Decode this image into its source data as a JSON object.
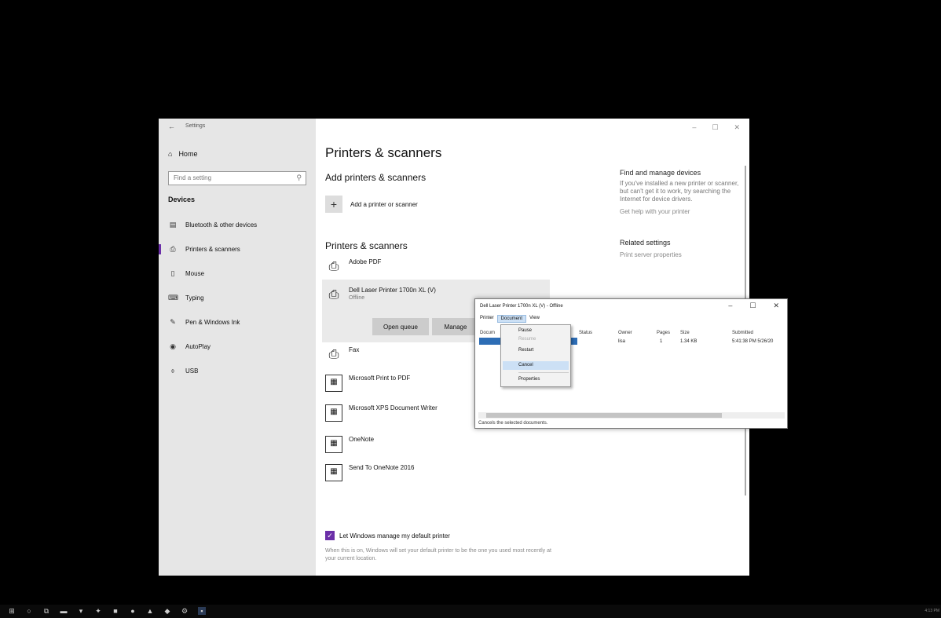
{
  "window": {
    "title": "Settings",
    "back": "←",
    "min": "–",
    "max": "☐",
    "close": "✕"
  },
  "sidebar": {
    "home": "Home",
    "search_placeholder": "Find a setting",
    "section": "Devices",
    "items": [
      {
        "label": "Bluetooth & other devices",
        "icon": "bluetooth-devices-icon"
      },
      {
        "label": "Printers & scanners",
        "icon": "printer-icon",
        "active": true
      },
      {
        "label": "Mouse",
        "icon": "mouse-icon"
      },
      {
        "label": "Typing",
        "icon": "keyboard-icon"
      },
      {
        "label": "Pen & Windows Ink",
        "icon": "pen-icon"
      },
      {
        "label": "AutoPlay",
        "icon": "autoplay-icon"
      },
      {
        "label": "USB",
        "icon": "usb-icon"
      }
    ]
  },
  "main": {
    "title": "Printers & scanners",
    "add_heading": "Add printers & scanners",
    "add_label": "Add a printer or scanner",
    "list_heading": "Printers & scanners",
    "printers": [
      {
        "name": "Adobe PDF",
        "status": ""
      },
      {
        "name": "Dell Laser Printer 1700n XL (V)",
        "status": "Offline"
      },
      {
        "name": "Fax",
        "status": ""
      },
      {
        "name": "Microsoft Print to PDF",
        "status": ""
      },
      {
        "name": "Microsoft XPS Document Writer",
        "status": ""
      },
      {
        "name": "OneNote",
        "status": ""
      },
      {
        "name": "Send To OneNote 2016",
        "status": ""
      }
    ],
    "open_queue": "Open queue",
    "manage": "Manage",
    "default_checkbox": "Let Windows manage my default printer",
    "default_note": "When this is on, Windows will set your default printer to be the one you used most recently at your current location."
  },
  "right": {
    "find_title": "Find and manage devices",
    "find_text": "If you've installed a new printer or scanner, but can't get it to work, try searching the Internet for device drivers.",
    "help_link": "Get help with your printer",
    "related_title": "Related settings",
    "print_server": "Print server properties"
  },
  "queue_dialog": {
    "title": "Dell Laser Printer 1700n XL (V) - Offline",
    "menus": [
      "Printer",
      "Document",
      "View"
    ],
    "columns": [
      "Docum",
      "Status",
      "Owner",
      "Pages",
      "Size",
      "Submitted"
    ],
    "row": {
      "doc": "",
      "status": "",
      "owner": "lisa",
      "pages": "1",
      "size": "1.34 KB",
      "submitted": "5:41:38 PM 5/26/20"
    },
    "status_bar": "Cancels the selected documents."
  },
  "document_menu": {
    "items": [
      {
        "label": "Pause",
        "disabled": false
      },
      {
        "label": "Resume",
        "disabled": true
      },
      {
        "label": "Restart",
        "disabled": false
      },
      {
        "label": "Cancel",
        "disabled": false,
        "highlight": true
      },
      {
        "label": "Properties",
        "disabled": false
      }
    ]
  },
  "taskbar": {
    "clock": "4:13 PM"
  },
  "colors": {
    "accent": "#6b2fa8",
    "highlight": "#cce0f5",
    "selection": "#2d6db5"
  }
}
